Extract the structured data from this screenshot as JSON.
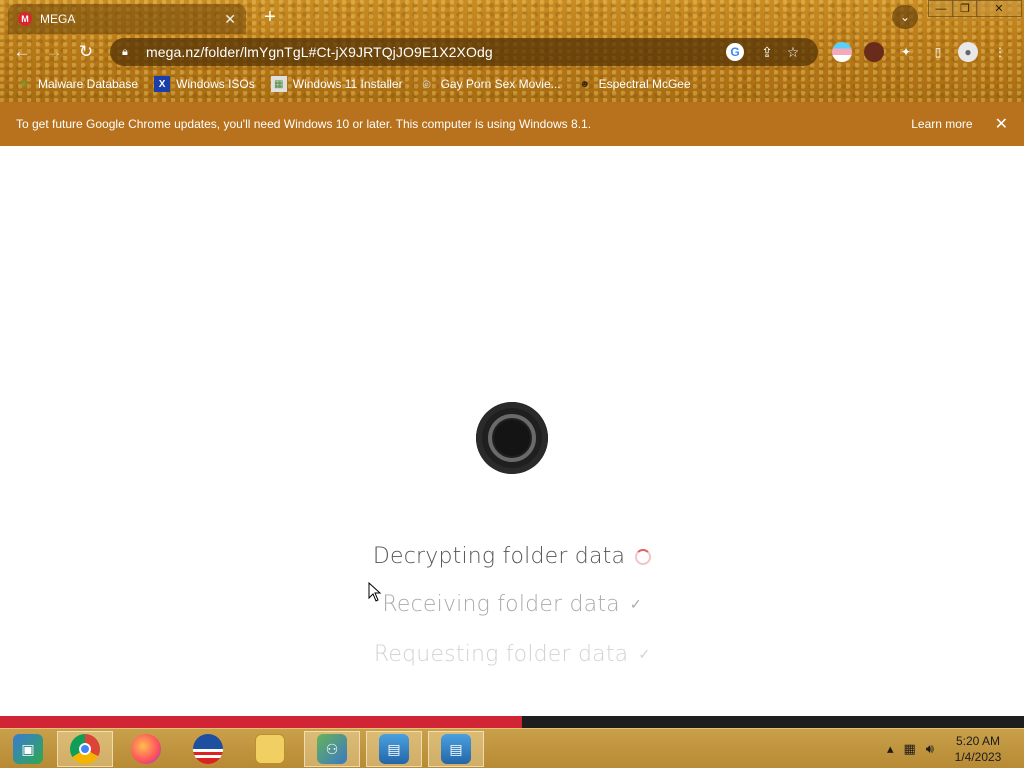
{
  "browser": {
    "tab_title": "MEGA",
    "tab_favicon": "M",
    "tab_close": "✕",
    "new_tab": "+",
    "url": "mega.nz/folder/lmYgnTgL#Ct-jX9JRTQjJO9E1X2XOdg",
    "window_controls": {
      "minimize": "—",
      "restore": "❐",
      "close": "✕"
    }
  },
  "bookmarks": [
    {
      "label": "Malware Database",
      "icon": "leaf-icon"
    },
    {
      "label": "Windows ISOs",
      "icon": "x-icon"
    },
    {
      "label": "Windows 11 Installer",
      "icon": "image-icon"
    },
    {
      "label": "Gay Porn Sex Movie...",
      "icon": "film-icon"
    },
    {
      "label": "Espectral McGee",
      "icon": "avatar-icon"
    }
  ],
  "infobar": {
    "message": "To get future Google Chrome updates, you'll need Windows 10 or later. This computer is using Windows 8.1.",
    "learn_more": "Learn more",
    "close": "✕"
  },
  "loading": {
    "steps": [
      {
        "label": "Decrypting folder data",
        "status": "in-progress"
      },
      {
        "label": "Receiving folder data",
        "status": "done",
        "mark": "✓"
      },
      {
        "label": "Requesting folder data",
        "status": "done",
        "mark": "✓"
      }
    ],
    "progress": 0.51,
    "progress_color": "#d12535"
  },
  "taskbar": {
    "apps": [
      "desktop-icon",
      "chrome-icon",
      "firefox-icon",
      "obama-icon",
      "file-explorer-icon",
      "network-icon",
      "remote-desktop-icon",
      "remote-desktop-icon"
    ],
    "clock_time": "5:20 AM",
    "clock_date": "1/4/2023"
  }
}
